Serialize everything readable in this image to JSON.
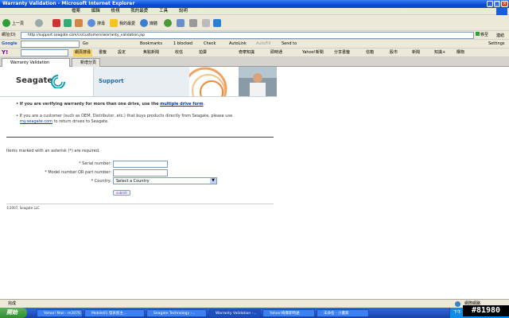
{
  "window": {
    "title": "Warranty Validation - Microsoft Internet Explorer"
  },
  "menubar": {
    "items": [
      "檔案",
      "編輯",
      "檢視",
      "我的最愛",
      "工具",
      "說明"
    ]
  },
  "toolbar": {
    "back": "上一頁",
    "search": "搜尋",
    "favorites": "我的最愛",
    "media": "媒體"
  },
  "address": {
    "label": "網址(D)",
    "url": "http://support.seagate.com/cs/customers/warranty_validation.jsp",
    "go": "移至",
    "links": "連結"
  },
  "google": {
    "label": "Google",
    "go": "Go",
    "bookmarks": "Bookmarks",
    "blocked": "1 blocked",
    "check": "Check",
    "autolink": "AutoLink",
    "autofill": "AutoFill",
    "send": "Send to",
    "settings": "Settings"
  },
  "yahoo": {
    "items": [
      "網頁搜尋",
      "書籤",
      "設定",
      "焦點新聞",
      "收信",
      "拍賣",
      "奇摩知識",
      "即時通",
      "Yahoo!新聞",
      "分享書籤",
      "信箱",
      "股市",
      "新聞",
      "知識+",
      "購物"
    ]
  },
  "tabs": [
    {
      "label": "Warranty Validation"
    },
    {
      "label": "新增分頁"
    }
  ],
  "page": {
    "brand": "Seagate",
    "section": "Support",
    "bullet1_pre": "If you are verifying warranty for more than one drive, use the",
    "bullet1_link": "multiple drive form",
    "bullet2_pre": "If you are a customer (such as OEM, Distributor, etc.) that buys products directly from Seagate, please use",
    "bullet2_link": "my.seagate.com",
    "bullet2_post": "to return drives to Seagate.",
    "required_note": "Items marked with an asterisk (*) are required.",
    "serial_label": "* Serial number:",
    "model_label": "* Model number OR part number:",
    "country_label": "* Country:",
    "country_value": "Select a Country",
    "submit": "submit",
    "copyright": "©2007, Seagate LLC"
  },
  "status": {
    "left": "完成",
    "zone": "網際網路"
  },
  "taskbar": {
    "start": "開始",
    "items": [
      "Yahoo! Mail - m3076...",
      "Mobile01 發表新主...",
      "Seagate Technology -...",
      "Warranty Validation -...",
      "Yahoo!奇摩即時通",
      "未命名 - 小畫家"
    ],
    "clock": "下午"
  },
  "watermark": "#81980",
  "colors": {
    "seagate_teal": "#00a0b0",
    "link": "#0033cc",
    "xp_blue": "#0a4ad6"
  }
}
